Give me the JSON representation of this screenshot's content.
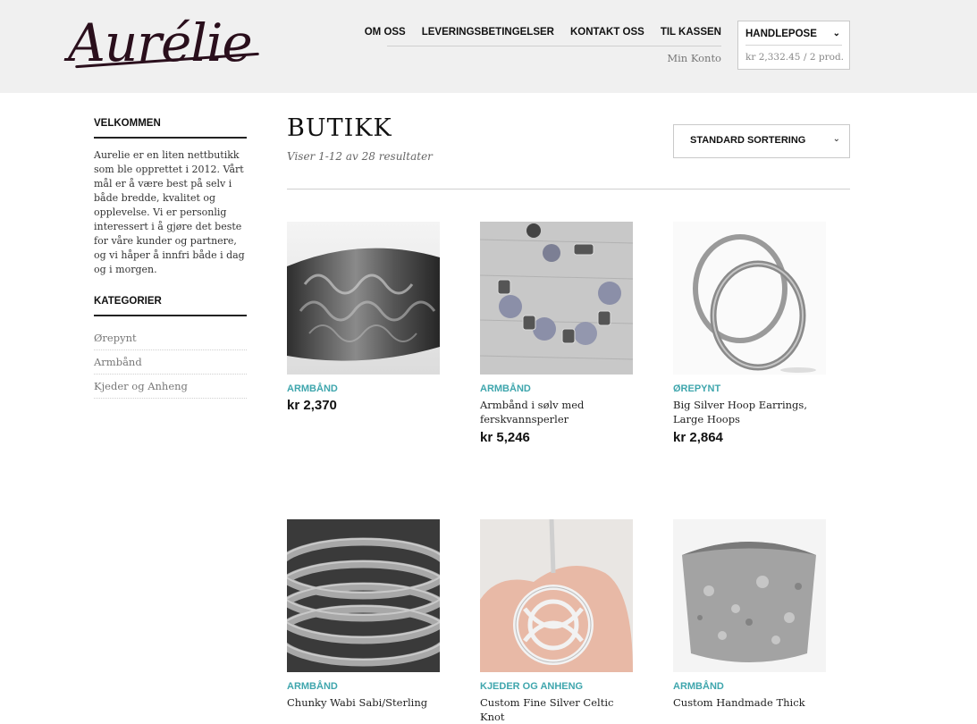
{
  "header": {
    "logo": "Aurélie",
    "nav": [
      "OM OSS",
      "LEVERINGSBETINGELSER",
      "KONTAKT OSS",
      "TIL KASSEN"
    ],
    "account": "Min Konto",
    "cart": {
      "title": "HANDLEPOSE",
      "total": "kr 2,332.45",
      "count": "/ 2 prod."
    }
  },
  "sidebar": {
    "welcome_heading": "VELKOMMEN",
    "welcome_text": "Aurelie er en liten nettbutikk som ble opprettet i 2012. Vårt mål er å være best på selv i både bredde, kvalitet og opplevelse. Vi er personlig interessert i å gjøre det beste for våre kunder og partnere, og vi håper å innfri både i dag og i morgen.",
    "categories_heading": "KATEGORIER",
    "categories": [
      "Ørepynt",
      "Armbånd",
      "Kjeder og Anheng"
    ]
  },
  "main": {
    "title": "BUTIKK",
    "result_count": "Viser 1-12 av 28 resultater",
    "sort_label": "STANDARD SORTERING"
  },
  "products": [
    {
      "category": "ARMBÅND",
      "name": "",
      "price": "kr 2,370"
    },
    {
      "category": "ARMBÅND",
      "name": "Armbånd i sølv med ferskvannsperler",
      "price": "kr 5,246"
    },
    {
      "category": "ØREPYNT",
      "name": "Big Silver Hoop Earrings, Large Hoops",
      "price": "kr 2,864"
    },
    {
      "category": "ARMBÅND",
      "name": "Chunky Wabi Sabi/Sterling",
      "price": ""
    },
    {
      "category": "KJEDER OG ANHENG",
      "name": "Custom Fine Silver Celtic Knot",
      "price": ""
    },
    {
      "category": "ARMBÅND",
      "name": "Custom Handmade Thick",
      "price": ""
    }
  ],
  "colors": {
    "accent": "#3fa6ad",
    "header_bg": "#f0f0f0",
    "logo": "#2a0f1c"
  }
}
